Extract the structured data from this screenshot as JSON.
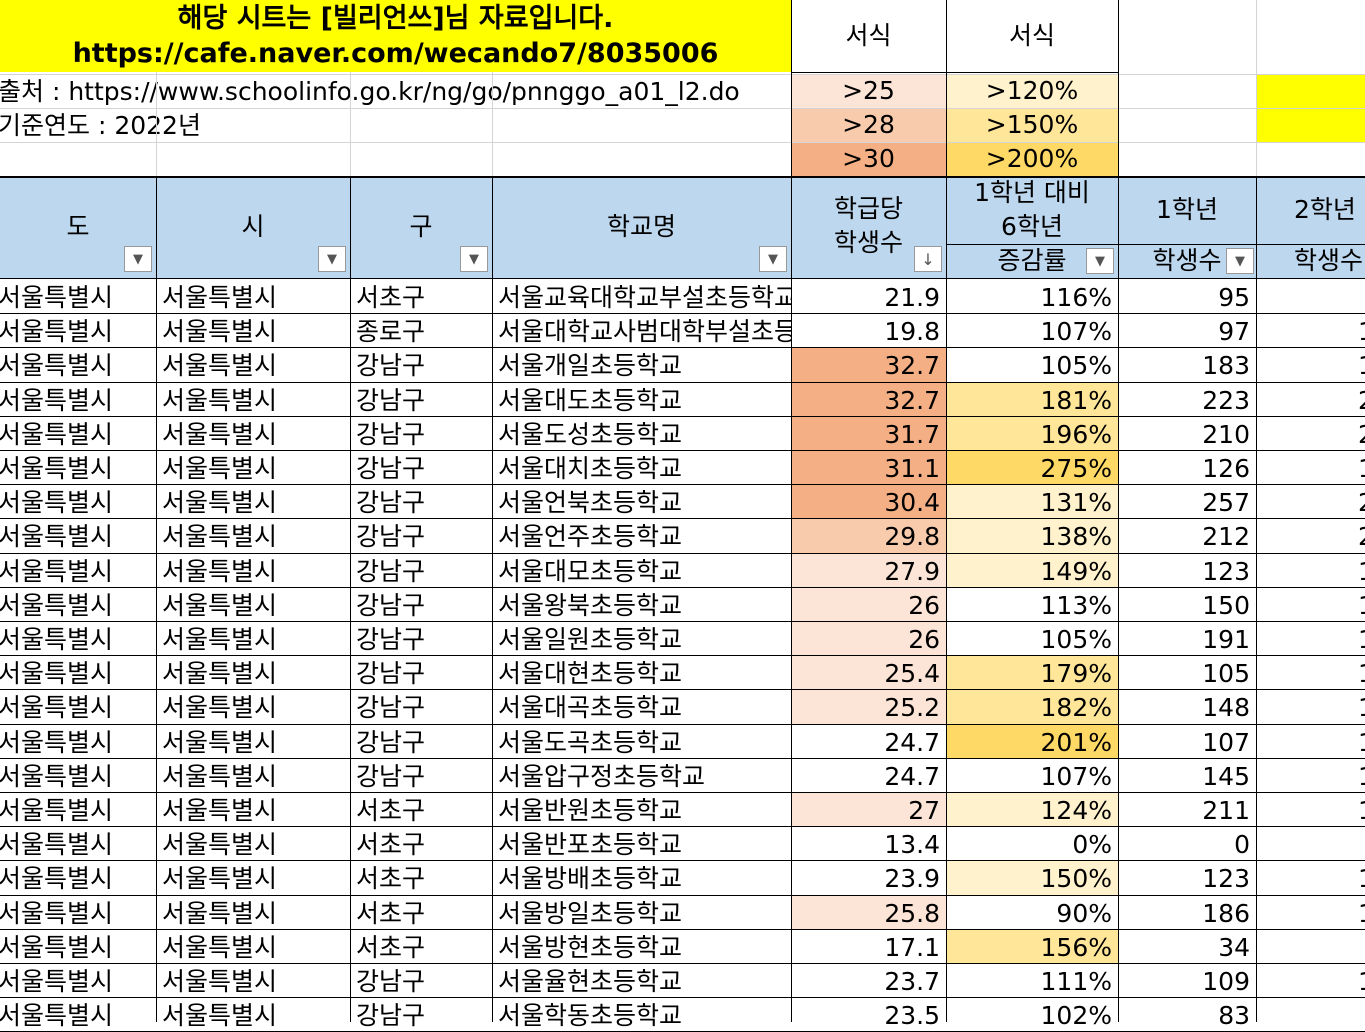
{
  "banner": {
    "line1": "해당 시트는 [빌리언쓰]님 자료입니다.",
    "line2": "https://cafe.naver.com/wecando7/8035006"
  },
  "info": {
    "source": "출처 : https://www.schoolinfo.go.kr/ng/go/pnnggo_a01_l2.do",
    "year": "기준연도 : 2022년"
  },
  "legend": {
    "label_a": "서식",
    "label_b": "서식",
    "a": [
      ">25",
      ">28",
      ">30"
    ],
    "b": [
      ">120%",
      ">150%",
      ">200%"
    ]
  },
  "headers": {
    "do": "도",
    "si": "시",
    "gu": "구",
    "school": "학교명",
    "per_class_1": "학급당",
    "per_class_2": "학생수",
    "growth_1": "1학년 대비",
    "growth_2": "6학년",
    "growth_3": "증감률",
    "g1_1": "1학년",
    "g1_2": "학생수",
    "g2_1": "2학년",
    "g2_2": "학생수"
  },
  "filter_icons": {
    "dropdown": "▼",
    "sort_desc": "↓"
  },
  "colors": {
    "banner": "#ffff00",
    "header": "#bdd7ee",
    "a1": "#fce4d6",
    "a2": "#f8cbad",
    "a3": "#f4b084",
    "b1": "#fff2cc",
    "b2": "#ffe699",
    "b3": "#ffd966"
  },
  "rows": [
    {
      "do": "서울특별시",
      "si": "서울특별시",
      "gu": "서초구",
      "school": "서울교육대학교부설초등학교",
      "per_class": "21.9",
      "growth": "116%",
      "g1": "95",
      "g2": ""
    },
    {
      "do": "서울특별시",
      "si": "서울특별시",
      "gu": "종로구",
      "school": "서울대학교사범대학부설초등학교",
      "per_class": "19.8",
      "growth": "107%",
      "g1": "97",
      "g2": "1"
    },
    {
      "do": "서울특별시",
      "si": "서울특별시",
      "gu": "강남구",
      "school": "서울개일초등학교",
      "per_class": "32.7",
      "growth": "105%",
      "g1": "183",
      "g2": "1"
    },
    {
      "do": "서울특별시",
      "si": "서울특별시",
      "gu": "강남구",
      "school": "서울대도초등학교",
      "per_class": "32.7",
      "growth": "181%",
      "g1": "223",
      "g2": "2"
    },
    {
      "do": "서울특별시",
      "si": "서울특별시",
      "gu": "강남구",
      "school": "서울도성초등학교",
      "per_class": "31.7",
      "growth": "196%",
      "g1": "210",
      "g2": "2"
    },
    {
      "do": "서울특별시",
      "si": "서울특별시",
      "gu": "강남구",
      "school": "서울대치초등학교",
      "per_class": "31.1",
      "growth": "275%",
      "g1": "126",
      "g2": "1"
    },
    {
      "do": "서울특별시",
      "si": "서울특별시",
      "gu": "강남구",
      "school": "서울언북초등학교",
      "per_class": "30.4",
      "growth": "131%",
      "g1": "257",
      "g2": "2"
    },
    {
      "do": "서울특별시",
      "si": "서울특별시",
      "gu": "강남구",
      "school": "서울언주초등학교",
      "per_class": "29.8",
      "growth": "138%",
      "g1": "212",
      "g2": "2"
    },
    {
      "do": "서울특별시",
      "si": "서울특별시",
      "gu": "강남구",
      "school": "서울대모초등학교",
      "per_class": "27.9",
      "growth": "149%",
      "g1": "123",
      "g2": "1"
    },
    {
      "do": "서울특별시",
      "si": "서울특별시",
      "gu": "강남구",
      "school": "서울왕북초등학교",
      "per_class": "26",
      "growth": "113%",
      "g1": "150",
      "g2": "1"
    },
    {
      "do": "서울특별시",
      "si": "서울특별시",
      "gu": "강남구",
      "school": "서울일원초등학교",
      "per_class": "26",
      "growth": "105%",
      "g1": "191",
      "g2": "1"
    },
    {
      "do": "서울특별시",
      "si": "서울특별시",
      "gu": "강남구",
      "school": "서울대현초등학교",
      "per_class": "25.4",
      "growth": "179%",
      "g1": "105",
      "g2": "1"
    },
    {
      "do": "서울특별시",
      "si": "서울특별시",
      "gu": "강남구",
      "school": "서울대곡초등학교",
      "per_class": "25.2",
      "growth": "182%",
      "g1": "148",
      "g2": "1"
    },
    {
      "do": "서울특별시",
      "si": "서울특별시",
      "gu": "강남구",
      "school": "서울도곡초등학교",
      "per_class": "24.7",
      "growth": "201%",
      "g1": "107",
      "g2": "1"
    },
    {
      "do": "서울특별시",
      "si": "서울특별시",
      "gu": "강남구",
      "school": "서울압구정초등학교",
      "per_class": "24.7",
      "growth": "107%",
      "g1": "145",
      "g2": "1"
    },
    {
      "do": "서울특별시",
      "si": "서울특별시",
      "gu": "서초구",
      "school": "서울반원초등학교",
      "per_class": "27",
      "growth": "124%",
      "g1": "211",
      "g2": "1"
    },
    {
      "do": "서울특별시",
      "si": "서울특별시",
      "gu": "서초구",
      "school": "서울반포초등학교",
      "per_class": "13.4",
      "growth": "0%",
      "g1": "0",
      "g2": ""
    },
    {
      "do": "서울특별시",
      "si": "서울특별시",
      "gu": "서초구",
      "school": "서울방배초등학교",
      "per_class": "23.9",
      "growth": "150%",
      "g1": "123",
      "g2": "1"
    },
    {
      "do": "서울특별시",
      "si": "서울특별시",
      "gu": "서초구",
      "school": "서울방일초등학교",
      "per_class": "25.8",
      "growth": "90%",
      "g1": "186",
      "g2": "1"
    },
    {
      "do": "서울특별시",
      "si": "서울특별시",
      "gu": "서초구",
      "school": "서울방현초등학교",
      "per_class": "17.1",
      "growth": "156%",
      "g1": "34",
      "g2": ""
    },
    {
      "do": "서울특별시",
      "si": "서울특별시",
      "gu": "강남구",
      "school": "서울율현초등학교",
      "per_class": "23.7",
      "growth": "111%",
      "g1": "109",
      "g2": "1"
    },
    {
      "do": "서울특별시",
      "si": "서울특별시",
      "gu": "강남구",
      "school": "서울학동초등학교",
      "per_class": "23.5",
      "growth": "102%",
      "g1": "83",
      "g2": ""
    }
  ]
}
